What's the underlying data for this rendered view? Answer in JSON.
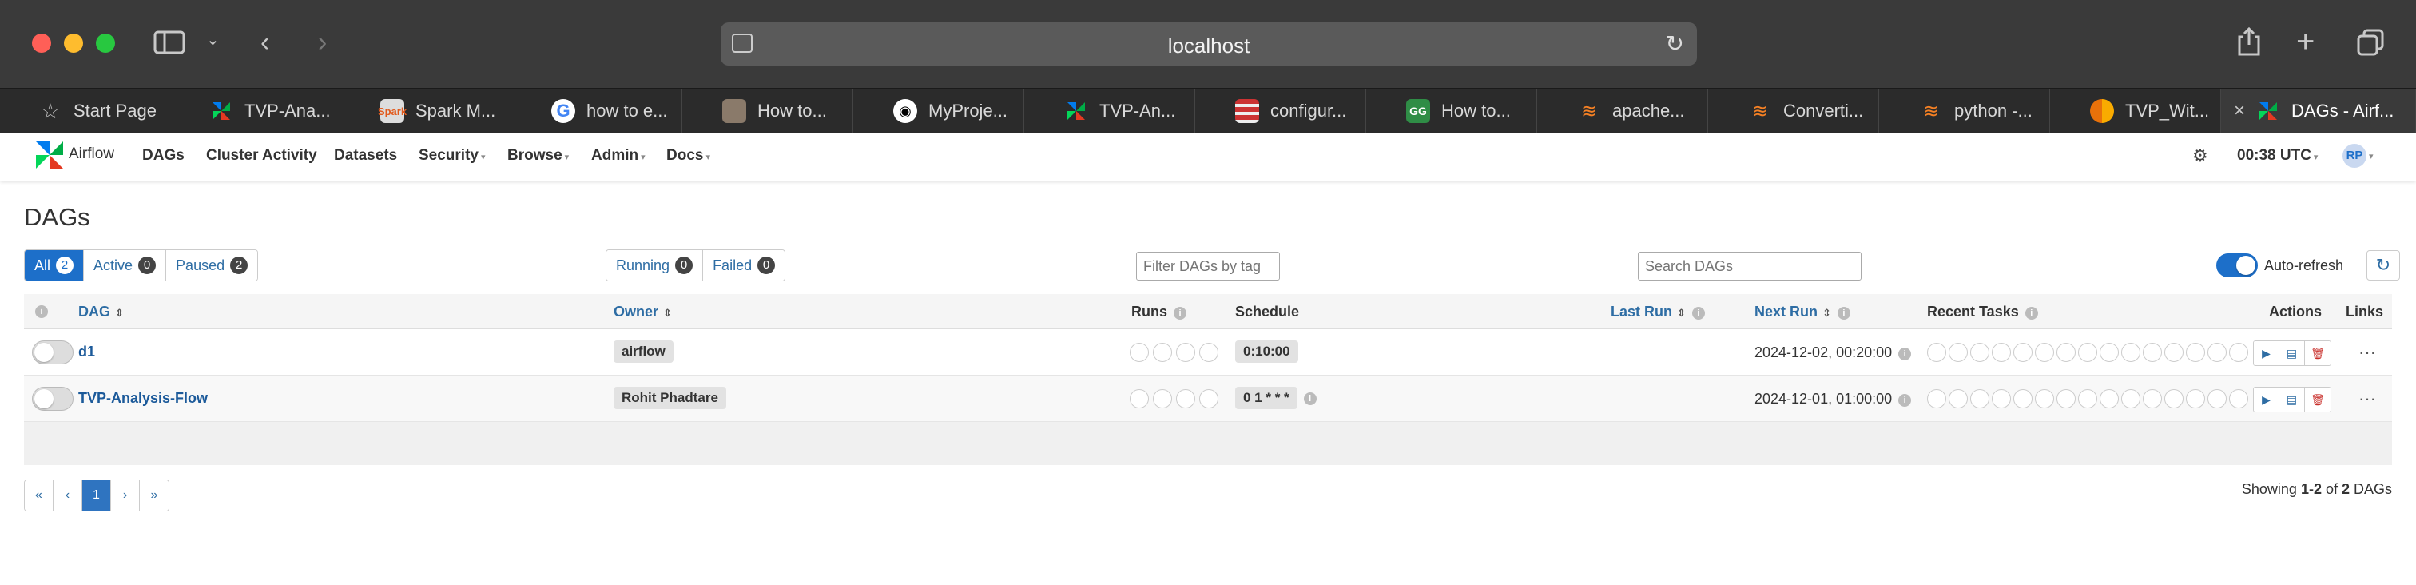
{
  "browser": {
    "url": "localhost",
    "tabs": [
      {
        "title": "Start Page",
        "icon": "star-icon"
      },
      {
        "title": "TVP-Ana...",
        "icon": "airflow-icon"
      },
      {
        "title": "Spark M...",
        "icon": "spark-icon"
      },
      {
        "title": "how to e...",
        "icon": "google-icon"
      },
      {
        "title": "How to...",
        "icon": "avatar-icon"
      },
      {
        "title": "MyProje...",
        "icon": "github-icon"
      },
      {
        "title": "TVP-An...",
        "icon": "airflow-icon"
      },
      {
        "title": "configur...",
        "icon": "config-icon"
      },
      {
        "title": "How to...",
        "icon": "gfg-icon"
      },
      {
        "title": "apache...",
        "icon": "stackoverflow-icon"
      },
      {
        "title": "Converti...",
        "icon": "stackoverflow-icon"
      },
      {
        "title": "python -...",
        "icon": "stackoverflow-icon"
      },
      {
        "title": "TVP_Wit...",
        "icon": "colab-icon"
      },
      {
        "title": "DAGs - Airf...",
        "icon": "airflow-icon"
      }
    ]
  },
  "nav": {
    "brand": "Airflow",
    "items": [
      "DAGs",
      "Cluster Activity",
      "Datasets",
      "Security",
      "Browse",
      "Admin",
      "Docs"
    ],
    "time": "00:38 UTC",
    "user": "RP"
  },
  "page": {
    "title": "DAGs",
    "filters": {
      "all_label": "All",
      "all_count": "2",
      "active_label": "Active",
      "active_count": "0",
      "paused_label": "Paused",
      "paused_count": "2",
      "running_label": "Running",
      "running_count": "0",
      "failed_label": "Failed",
      "failed_count": "0"
    },
    "tag_placeholder": "Filter DAGs by tag",
    "search_placeholder": "Search DAGs",
    "auto_refresh_label": "Auto-refresh",
    "columns": {
      "dag": "DAG",
      "owner": "Owner",
      "runs": "Runs",
      "schedule": "Schedule",
      "last_run": "Last Run",
      "next_run": "Next Run",
      "recent_tasks": "Recent Tasks",
      "actions": "Actions",
      "links": "Links"
    },
    "rows": [
      {
        "dag": "d1",
        "owner": "airflow",
        "schedule": "0:10:00",
        "next_run": "2024-12-02, 00:20:00"
      },
      {
        "dag": "TVP-Analysis-Flow",
        "owner": "Rohit Phadtare",
        "schedule": "0 1 * * *",
        "next_run": "2024-12-01, 01:00:00"
      }
    ],
    "pagination": {
      "first": "«",
      "prev": "‹",
      "current": "1",
      "next": "›",
      "last": "»"
    },
    "showing": {
      "prefix": "Showing ",
      "range": "1-2",
      "mid": " of ",
      "total": "2",
      "suffix": " DAGs"
    }
  },
  "colors": {
    "accent": "#1d6fc9",
    "link": "#2e6da4",
    "delete": "#c9302c"
  }
}
